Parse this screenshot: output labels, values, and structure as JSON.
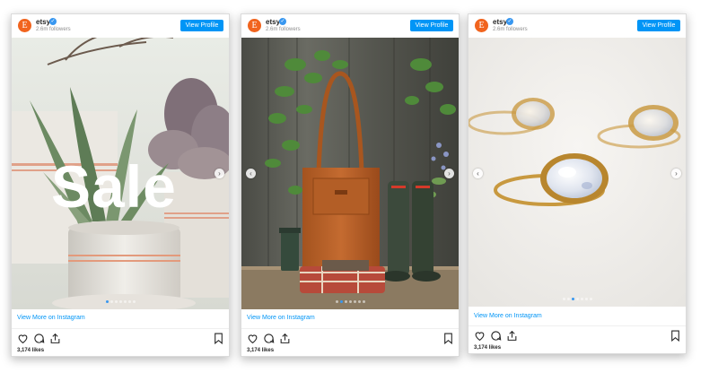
{
  "colors": {
    "accent": "#0095f6",
    "brand": "#f1641e"
  },
  "posts": [
    {
      "avatar_letter": "E",
      "username": "etsy",
      "followers": "2.6m followers",
      "view_profile": "View Profile",
      "overlay_text": "Sale",
      "image_description": "potted succulents",
      "view_more": "View More on Instagram",
      "likes": "3,174 likes",
      "active_slide": 0,
      "slides": 7
    },
    {
      "avatar_letter": "E",
      "username": "etsy",
      "followers": "2.6m followers",
      "view_profile": "View Profile",
      "image_description": "leather tote and rain boots",
      "view_more": "View More on Instagram",
      "likes": "3,174 likes",
      "active_slide": 1,
      "slides": 7
    },
    {
      "avatar_letter": "E",
      "username": "etsy",
      "followers": "2.6m followers",
      "view_profile": "View Profile",
      "image_description": "moonstone rings",
      "view_more": "View More on Instagram",
      "likes": "3,174 likes",
      "active_slide": 2,
      "slides": 7
    }
  ],
  "icons": [
    "heart-icon",
    "comment-icon",
    "share-icon",
    "bookmark-icon",
    "chevron-left-icon",
    "chevron-right-icon",
    "verified-icon"
  ]
}
